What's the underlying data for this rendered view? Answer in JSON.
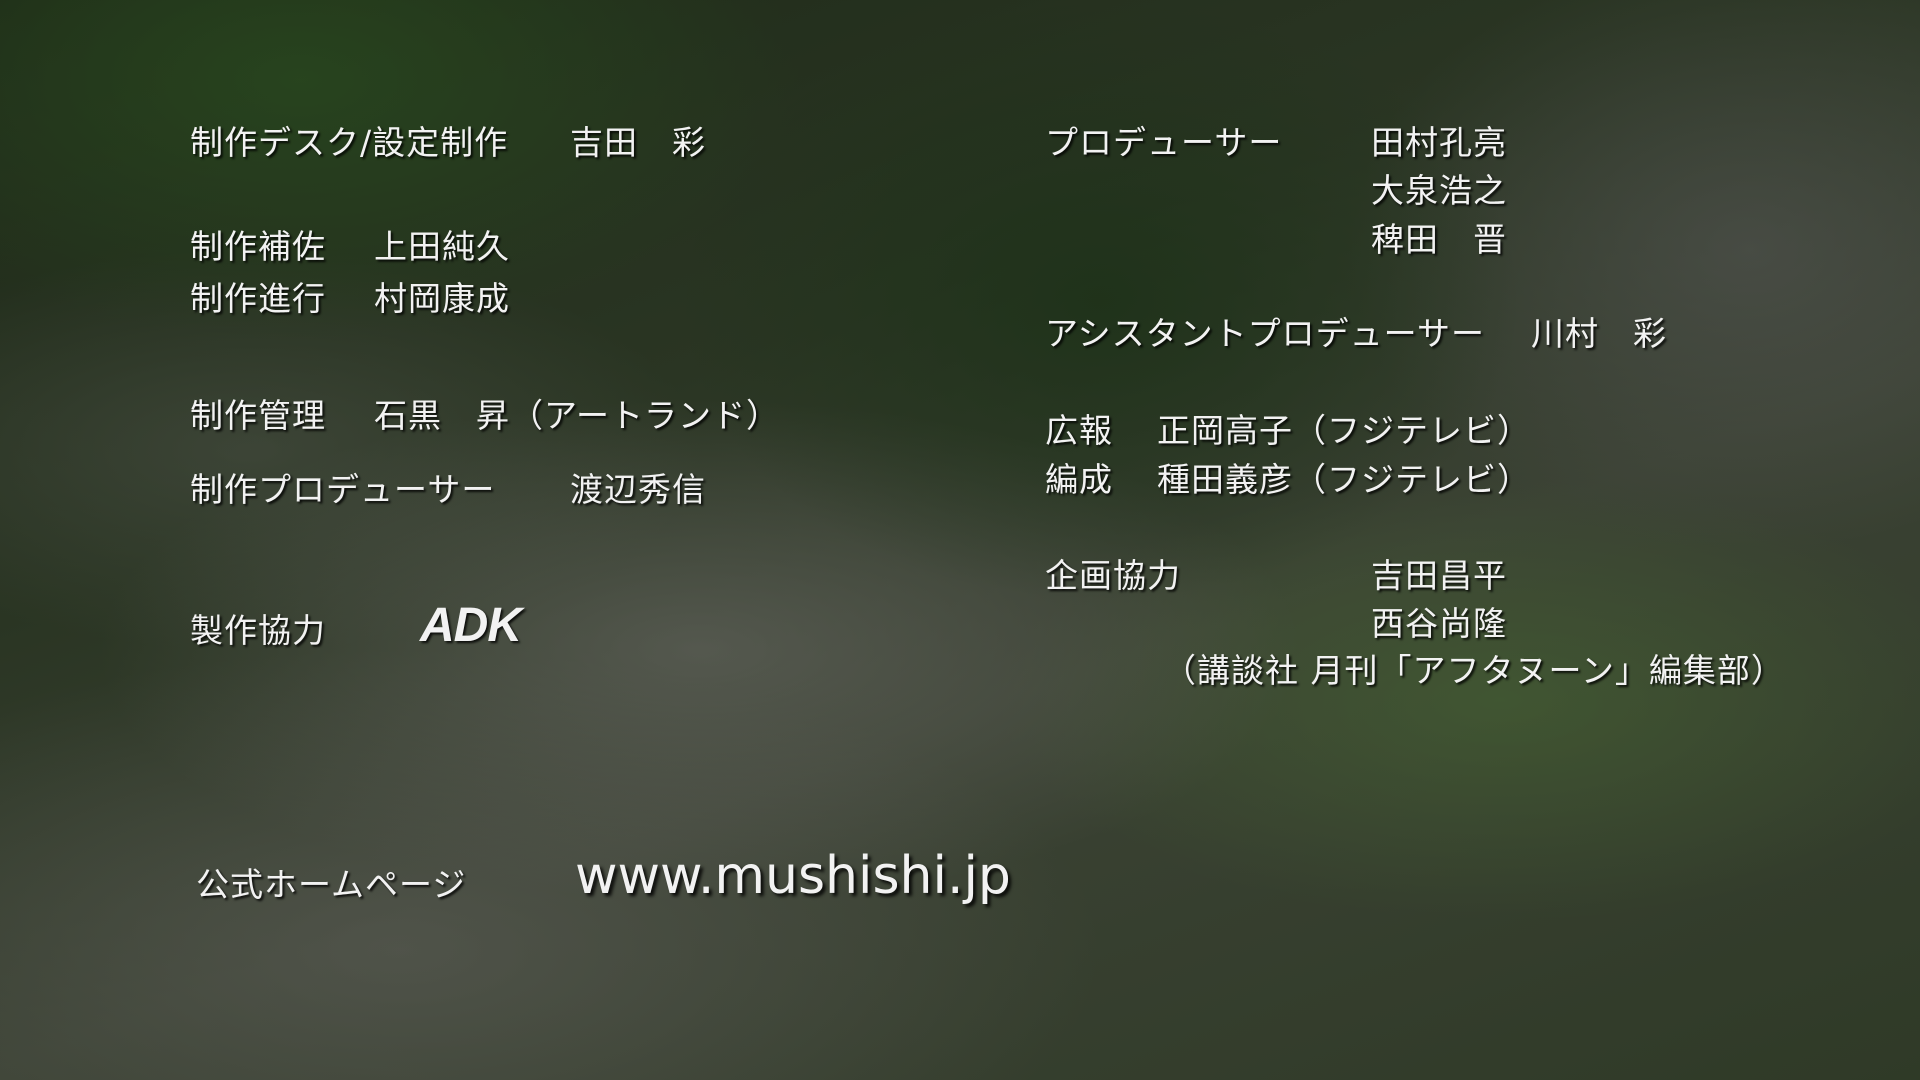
{
  "left": {
    "desk_role": "制作デスク/設定制作",
    "desk_name": "吉田　彩",
    "assist_role": "制作補佐",
    "assist_name": "上田純久",
    "progress_role": "制作進行",
    "progress_name": "村岡康成",
    "mgmt_role": "制作管理",
    "mgmt_name": "石黒　昇（アートランド）",
    "prod_role": "制作プロデューサー",
    "prod_name": "渡辺秀信",
    "coop_role": "製作協力",
    "coop_logo": "ADK"
  },
  "right": {
    "producer_role": "プロデューサー",
    "producers": [
      "田村孔亮",
      "大泉浩之",
      "稗田　晋"
    ],
    "asst_producer_role": "アシスタントプロデューサー",
    "asst_producer_name": "川村　彩",
    "pr_role": "広報",
    "pr_name": "正岡高子（フジテレビ）",
    "org_role": "編成",
    "org_name": "種田義彦（フジテレビ）",
    "plan_role": "企画協力",
    "plan_names": [
      "吉田昌平",
      "西谷尚隆"
    ],
    "plan_affiliation": "（講談社 月刊「アフタヌーン」編集部）"
  },
  "homepage": {
    "label": "公式ホームページ",
    "url": "www.mushishi.jp"
  }
}
